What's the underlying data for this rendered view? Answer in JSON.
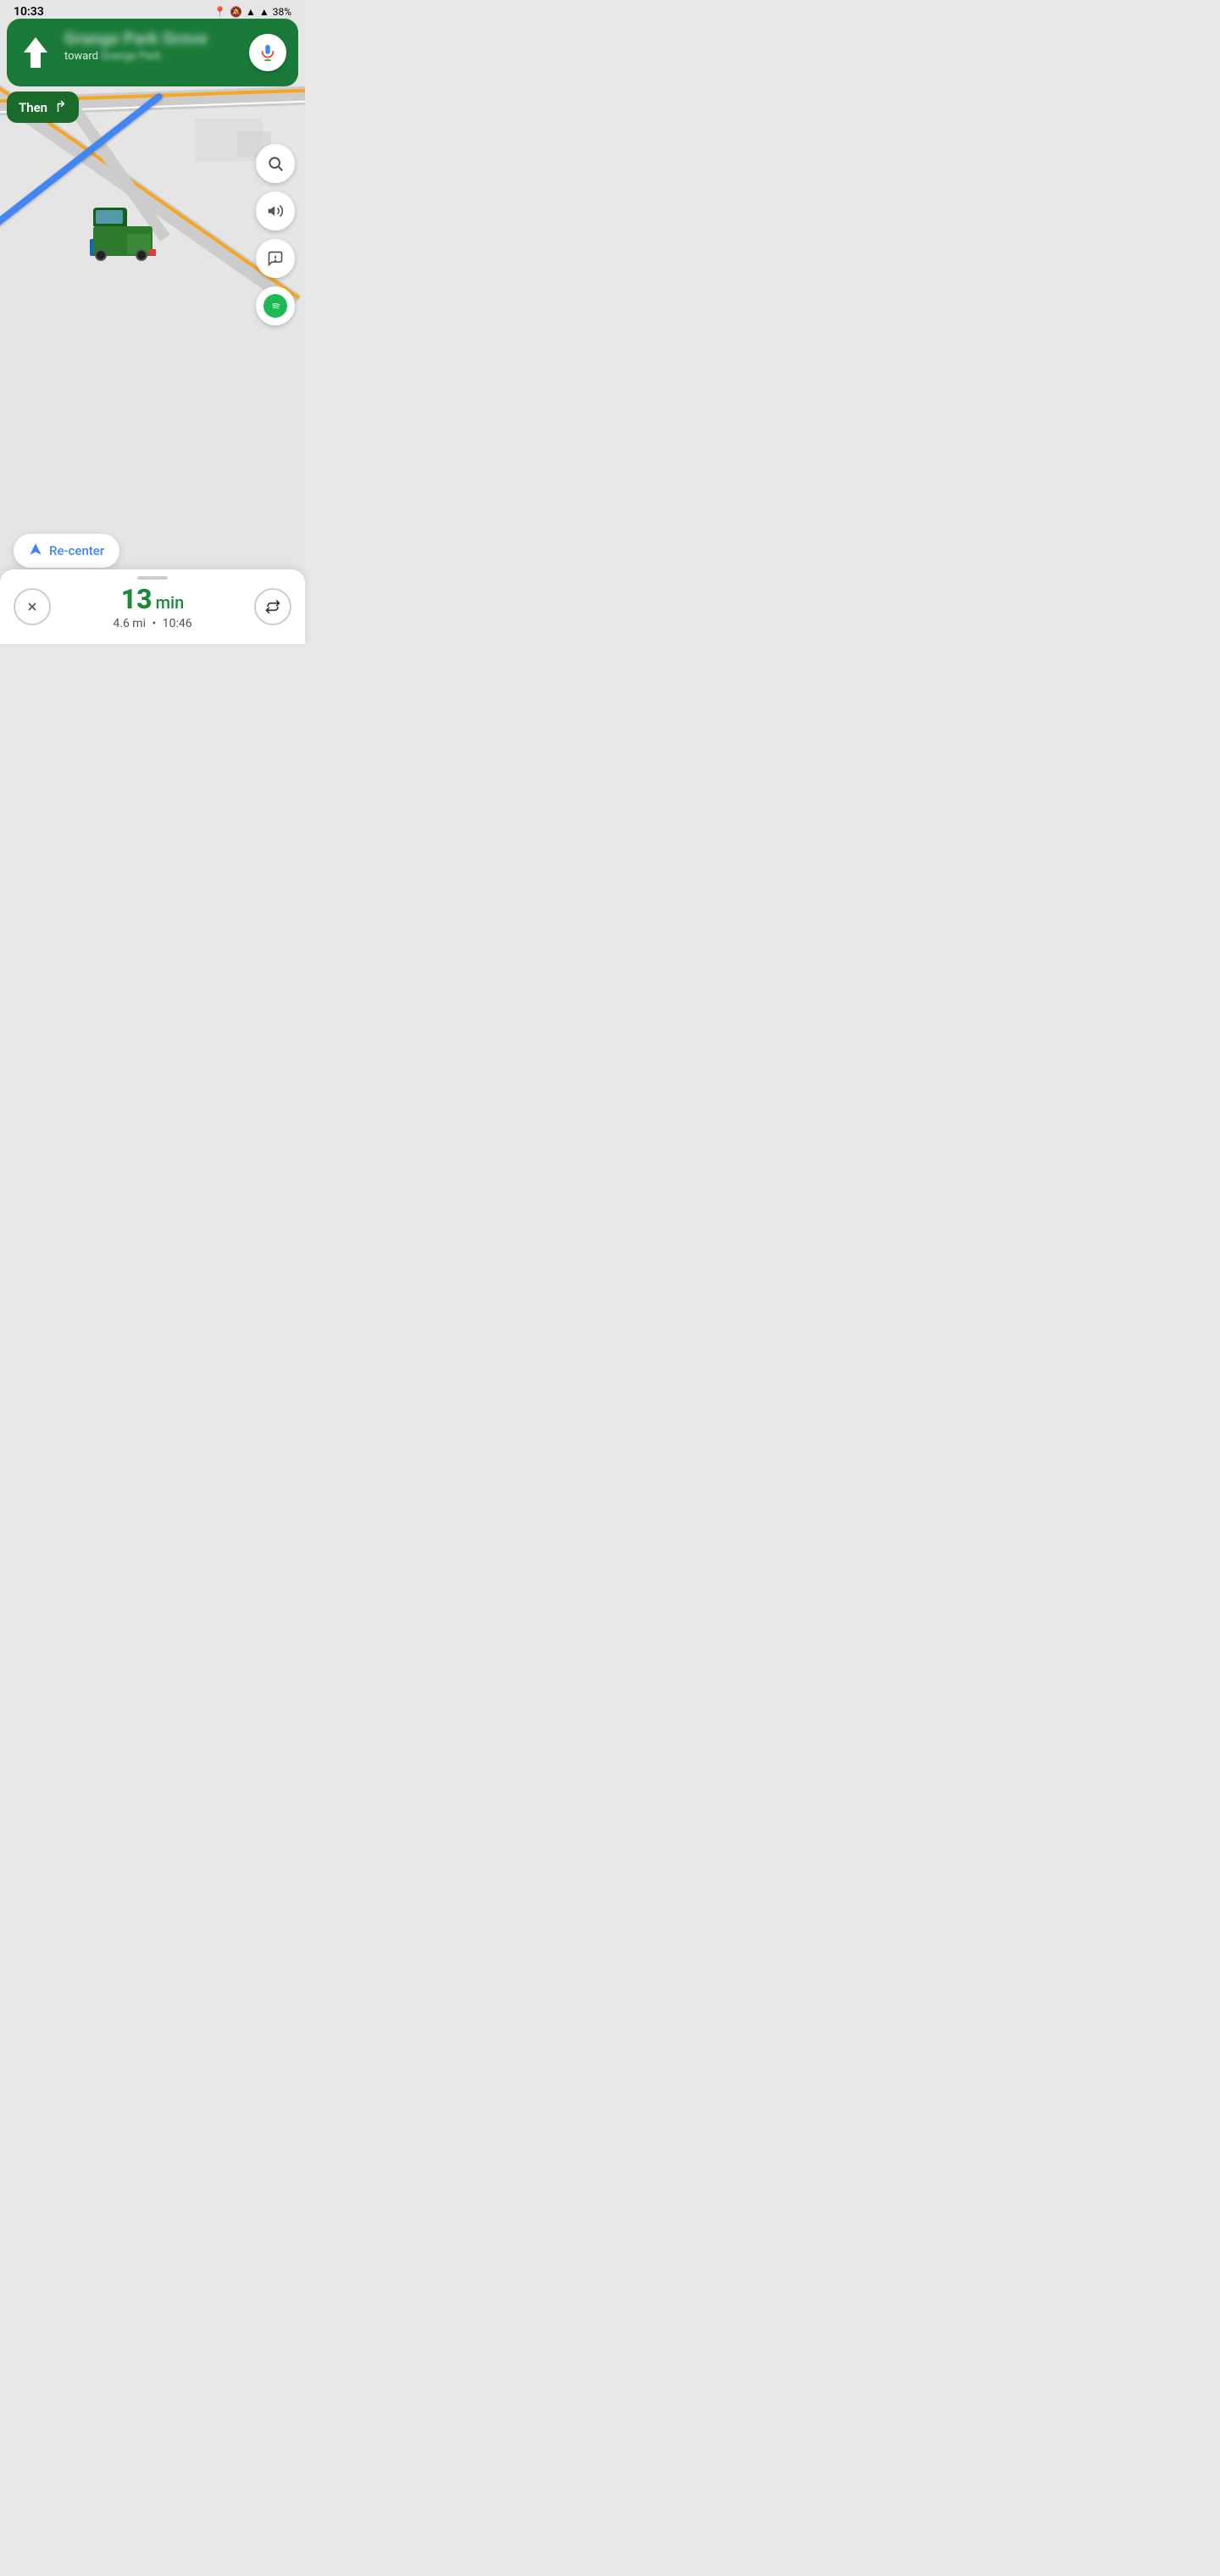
{
  "statusBar": {
    "time": "10:33",
    "battery": "38%"
  },
  "navigation": {
    "streetName": "Grange Park Grove",
    "toward": "toward",
    "destination": "Grange Park",
    "upArrowLabel": "straight ahead",
    "thenLabel": "Then",
    "thenTurnArrow": "↱"
  },
  "controls": {
    "searchIcon": "🔍",
    "volumeIcon": "🔊",
    "reportIcon": "💬",
    "spotifyIcon": "♫",
    "micIcon": "🎤"
  },
  "recenter": {
    "label": "Re-center",
    "icon": "▲"
  },
  "bottomBar": {
    "cancelLabel": "✕",
    "etaNumber": "13",
    "etaUnit": "min",
    "distance": "4.6 mi",
    "arrivalTime": "10:46",
    "routesIcon": "⇅"
  }
}
